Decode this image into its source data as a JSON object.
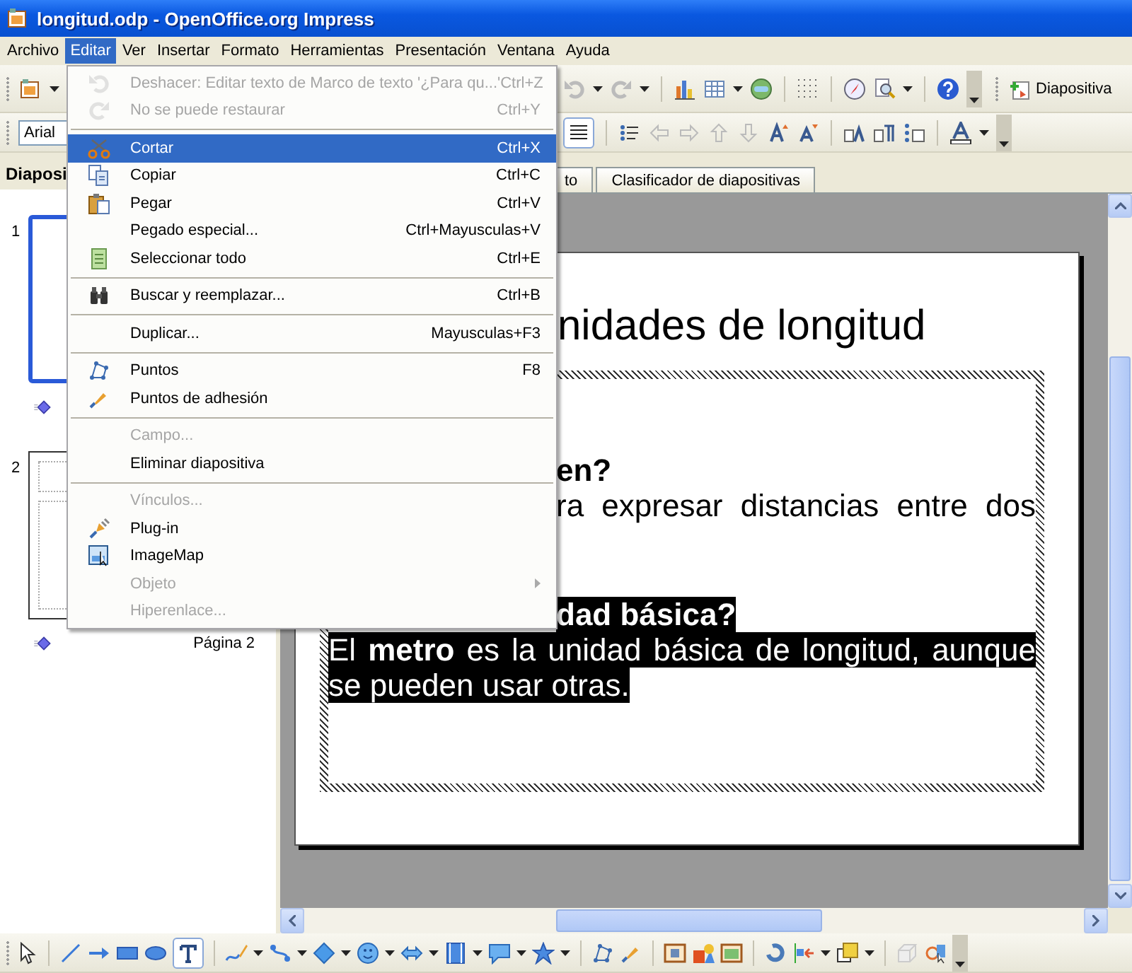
{
  "window": {
    "title": "longitud.odp - OpenOffice.org Impress"
  },
  "menu_bar": [
    {
      "label": "Archivo",
      "selected": false
    },
    {
      "label": "Editar",
      "selected": true
    },
    {
      "label": "Ver",
      "selected": false
    },
    {
      "label": "Insertar",
      "selected": false
    },
    {
      "label": "Formato",
      "selected": false
    },
    {
      "label": "Herramientas",
      "selected": false
    },
    {
      "label": "Presentación",
      "selected": false
    },
    {
      "label": "Ventana",
      "selected": false
    },
    {
      "label": "Ayuda",
      "selected": false
    }
  ],
  "standard_toolbar": {
    "slide_button": "Diapositiva"
  },
  "format_toolbar": {
    "font": "Arial",
    "justify_pressed": true
  },
  "edit_menu": {
    "items": [
      {
        "kind": "command",
        "label": "Deshacer: Editar texto de Marco de texto '¿Para qu...'",
        "shortcut": "Ctrl+Z",
        "disabled": true,
        "selected": false,
        "submenu": false
      },
      {
        "kind": "command",
        "label": "No se puede restaurar",
        "shortcut": "Ctrl+Y",
        "disabled": true,
        "selected": false,
        "submenu": false
      },
      {
        "kind": "separator"
      },
      {
        "kind": "command",
        "label": "Cortar",
        "shortcut": "Ctrl+X",
        "disabled": false,
        "selected": true,
        "submenu": false
      },
      {
        "kind": "command",
        "label": "Copiar",
        "shortcut": "Ctrl+C",
        "disabled": false,
        "selected": false,
        "submenu": false
      },
      {
        "kind": "command",
        "label": "Pegar",
        "shortcut": "Ctrl+V",
        "disabled": false,
        "selected": false,
        "submenu": false
      },
      {
        "kind": "command",
        "label": "Pegado especial...",
        "shortcut": "Ctrl+Mayusculas+V",
        "disabled": false,
        "selected": false,
        "submenu": false
      },
      {
        "kind": "command",
        "label": "Seleccionar todo",
        "shortcut": "Ctrl+E",
        "disabled": false,
        "selected": false,
        "submenu": false
      },
      {
        "kind": "separator"
      },
      {
        "kind": "command",
        "label": "Buscar y reemplazar...",
        "shortcut": "Ctrl+B",
        "disabled": false,
        "selected": false,
        "submenu": false
      },
      {
        "kind": "separator"
      },
      {
        "kind": "command",
        "label": "Duplicar...",
        "shortcut": "Mayusculas+F3",
        "disabled": false,
        "selected": false,
        "submenu": false
      },
      {
        "kind": "separator"
      },
      {
        "kind": "command",
        "label": "Puntos",
        "shortcut": "F8",
        "disabled": false,
        "selected": false,
        "submenu": false
      },
      {
        "kind": "command",
        "label": "Puntos de adhesión",
        "disabled": false,
        "selected": false,
        "submenu": false
      },
      {
        "kind": "separator"
      },
      {
        "kind": "command",
        "label": "Campo...",
        "disabled": true,
        "selected": false,
        "submenu": false
      },
      {
        "kind": "command",
        "label": "Eliminar diapositiva",
        "disabled": false,
        "selected": false,
        "submenu": false
      },
      {
        "kind": "separator"
      },
      {
        "kind": "command",
        "label": "Vínculos...",
        "disabled": true,
        "selected": false,
        "submenu": false
      },
      {
        "kind": "command",
        "label": "Plug-in",
        "disabled": false,
        "selected": false,
        "submenu": false
      },
      {
        "kind": "command",
        "label": "ImageMap",
        "disabled": false,
        "selected": false,
        "submenu": false
      },
      {
        "kind": "command",
        "label": "Objeto",
        "disabled": true,
        "selected": false,
        "submenu": true
      },
      {
        "kind": "command",
        "label": "Hiperenlace...",
        "disabled": true,
        "selected": false,
        "submenu": false
      }
    ]
  },
  "slides_pane": {
    "title": "Diaposi",
    "slides": [
      {
        "number": "1",
        "selected": true
      },
      {
        "number": "2",
        "selected": false,
        "name": "Página 2"
      }
    ]
  },
  "view_tabs": [
    {
      "label": "to",
      "selected": false
    },
    {
      "label": "Clasificador de diapositivas",
      "selected": false
    }
  ],
  "slide": {
    "title": "nidades de longitud",
    "paragraphs": [
      {
        "heading": {
          "text": "en?",
          "cut": true,
          "highlighted": false
        },
        "lines": [
          {
            "text": "ra expresar distancias entre dos",
            "cut": true,
            "highlighted": false,
            "wraps": true
          }
        ]
      },
      {
        "heading": {
          "text": "dad básica?",
          "cut": true,
          "highlighted": true
        },
        "lines": [
          {
            "text": "El **metro** es la unidad básica de longitud, aunque",
            "cut": false,
            "highlighted": true,
            "wraps": true
          },
          {
            "text": "se pueden usar otras.",
            "cut": false,
            "highlighted": true,
            "wraps": false
          }
        ]
      }
    ]
  },
  "drawing_toolbar": {
    "text_tool_pressed": true
  }
}
